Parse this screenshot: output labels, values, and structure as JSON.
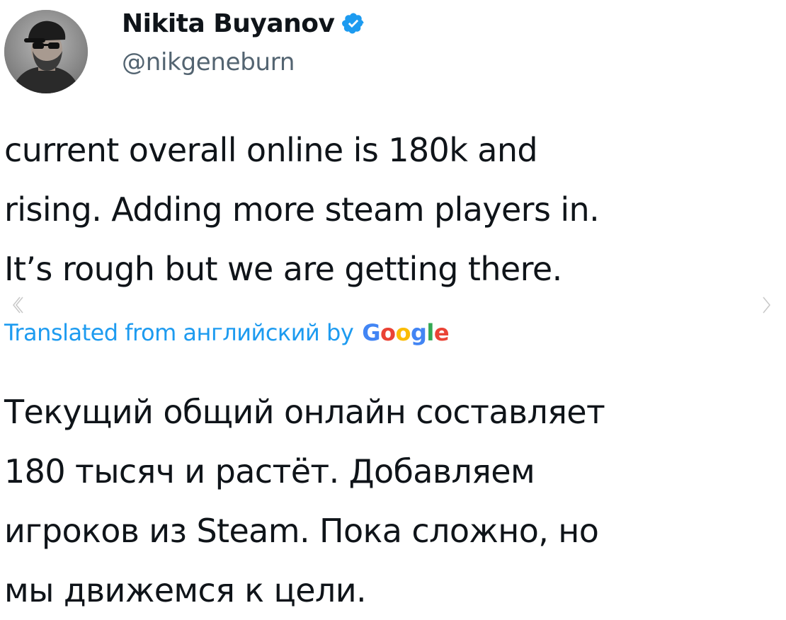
{
  "author": {
    "name": "Nikita Buyanov",
    "handle": "@nikgeneburn",
    "verified": true,
    "badge_color": "#1d9bf0"
  },
  "avatar_icon": "user-photo",
  "tweet": {
    "original_lines": [
      "current overall online is 180k and",
      "rising.  Adding more steam players in.",
      "It’s rough but we are getting there."
    ]
  },
  "translation": {
    "label": "Translated from английский by",
    "provider": [
      "G",
      "o",
      "o",
      "g",
      "l",
      "e"
    ],
    "label_color": "#1d9bf0",
    "lines": [
      "Текущий общий онлайн составляет",
      "180 тысяч и растёт. Добавляем",
      "игроков из Steam. Пока сложно, но",
      "мы движемся к цели."
    ]
  },
  "nav": {
    "prev_icon": "chevron-left-icon",
    "next_icon": "chevron-right-icon"
  }
}
